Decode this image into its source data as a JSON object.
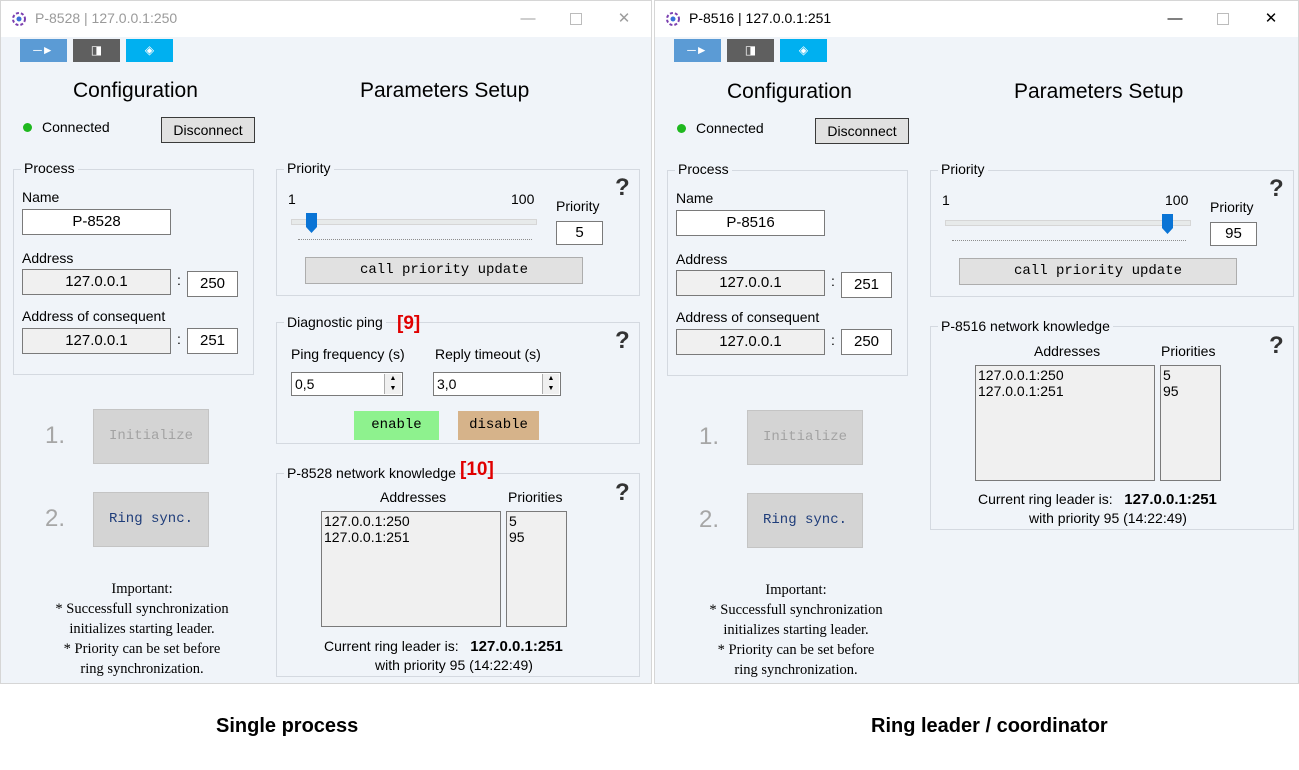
{
  "captions": {
    "left": "Single process",
    "right": "Ring leader / coordinator"
  },
  "toolbar": {
    "icons": [
      "arrow-right-icon",
      "book-icon",
      "diamond-icon"
    ],
    "glyph1": "─►",
    "glyph2": "◨",
    "glyph3": "◈"
  },
  "window_controls": {
    "min": "—",
    "close": "✕"
  },
  "left": {
    "title": "P-8528 | 127.0.0.1:250",
    "config_title": "Configuration",
    "params_title": "Parameters Setup",
    "status": "Connected",
    "disconnect_label": "Disconnect",
    "process_group": "Process",
    "name_label": "Name",
    "name_value": "P-8528",
    "address_label": "Address",
    "address_ip": "127.0.0.1",
    "address_port": "250",
    "consequent_label": "Address of consequent",
    "consequent_ip": "127.0.0.1",
    "consequent_port": "251",
    "colon": ":",
    "step1": "1.",
    "step2": "2.",
    "initialize_label": "Initialize",
    "ring_sync_label": "Ring sync.",
    "note_lines": [
      "Important:",
      "* Successfull synchronization",
      "initializes starting leader.",
      "* Priority can be set before",
      "ring synchronization."
    ],
    "priority_group": "Priority",
    "slider_min": "1",
    "slider_max": "100",
    "priority_label": "Priority",
    "priority_value": "5",
    "slider_level": 5,
    "call_priority_label": "call priority update",
    "diag_group": "Diagnostic ping",
    "diag_annotation": "[9]",
    "ping_freq_label": "Ping frequency (s)",
    "ping_freq_value": "0,5",
    "reply_timeout_label": "Reply timeout (s)",
    "reply_timeout_value": "3,0",
    "enable_label": "enable",
    "disable_label": "disable",
    "knowledge_group": "P-8528 network knowledge",
    "knowledge_annotation": "[10]",
    "addresses_header": "Addresses",
    "priorities_header": "Priorities",
    "addresses": [
      "127.0.0.1:250",
      "127.0.0.1:251"
    ],
    "priorities": [
      "5",
      "95"
    ],
    "leader_prefix": "Current ring leader is:",
    "leader_value": "127.0.0.1:251",
    "leader_detail": "with priority 95 (14:22:49)",
    "help": "?"
  },
  "right": {
    "title": "P-8516 | 127.0.0.1:251",
    "config_title": "Configuration",
    "params_title": "Parameters Setup",
    "status": "Connected",
    "disconnect_label": "Disconnect",
    "process_group": "Process",
    "name_label": "Name",
    "name_value": "P-8516",
    "address_label": "Address",
    "address_ip": "127.0.0.1",
    "address_port": "251",
    "consequent_label": "Address of consequent",
    "consequent_ip": "127.0.0.1",
    "consequent_port": "250",
    "colon": ":",
    "step1": "1.",
    "step2": "2.",
    "initialize_label": "Initialize",
    "ring_sync_label": "Ring sync.",
    "note_lines": [
      "Important:",
      "* Successfull synchronization",
      "initializes starting leader.",
      "* Priority can be set before",
      "ring synchronization."
    ],
    "priority_group": "Priority",
    "slider_min": "1",
    "slider_max": "100",
    "priority_label": "Priority",
    "priority_value": "95",
    "slider_level": 95,
    "call_priority_label": "call priority update",
    "knowledge_group": "P-8516 network knowledge",
    "addresses_header": "Addresses",
    "priorities_header": "Priorities",
    "addresses": [
      "127.0.0.1:250",
      "127.0.0.1:251"
    ],
    "priorities": [
      "5",
      "95"
    ],
    "leader_prefix": "Current ring leader is:",
    "leader_value": "127.0.0.1:251",
    "leader_detail": "with priority 95 (14:22:49)",
    "help": "?"
  },
  "colors": {
    "connected": "#1fb81f",
    "enable_bg": "#8ef28e",
    "disable_bg": "#d6b38a",
    "annotation": "#e00000",
    "thumb": "#0a74d5"
  }
}
